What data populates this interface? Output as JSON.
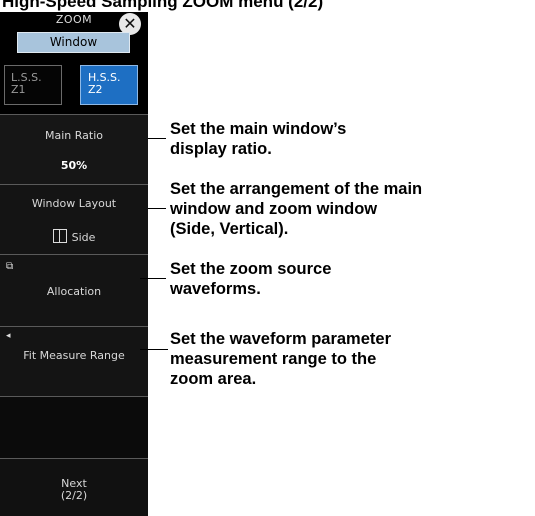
{
  "heading": "High-Speed Sampling ZOOM menu (2/2)",
  "menu": {
    "title": "ZOOM",
    "close_icon": "close-icon",
    "window_tab": "Window",
    "seg_left": {
      "line1": "L.S.S.",
      "line2": "Z1"
    },
    "seg_right": {
      "line1": "H.S.S.",
      "line2": "Z2"
    },
    "main_ratio": {
      "label": "Main Ratio",
      "value": "50%"
    },
    "window_layout": {
      "label": "Window Layout",
      "value": "Side",
      "icon": "side-layout-icon"
    },
    "allocation": {
      "label": "Allocation",
      "icon": "submenu-icon"
    },
    "fit_measure": {
      "label": "Fit Measure Range",
      "icon": "triangle-left-icon"
    },
    "next": {
      "line1": "Next",
      "line2": "(2/2)"
    }
  },
  "descriptions": {
    "main_ratio": [
      "Set the main window’s",
      "display ratio."
    ],
    "window_layout": [
      "Set the arrangement of the main",
      "window and zoom window",
      "(Side, Vertical)."
    ],
    "allocation": [
      "Set the zoom source",
      "waveforms."
    ],
    "fit_measure": [
      "Set the waveform parameter",
      "measurement range to the",
      "zoom area."
    ]
  }
}
